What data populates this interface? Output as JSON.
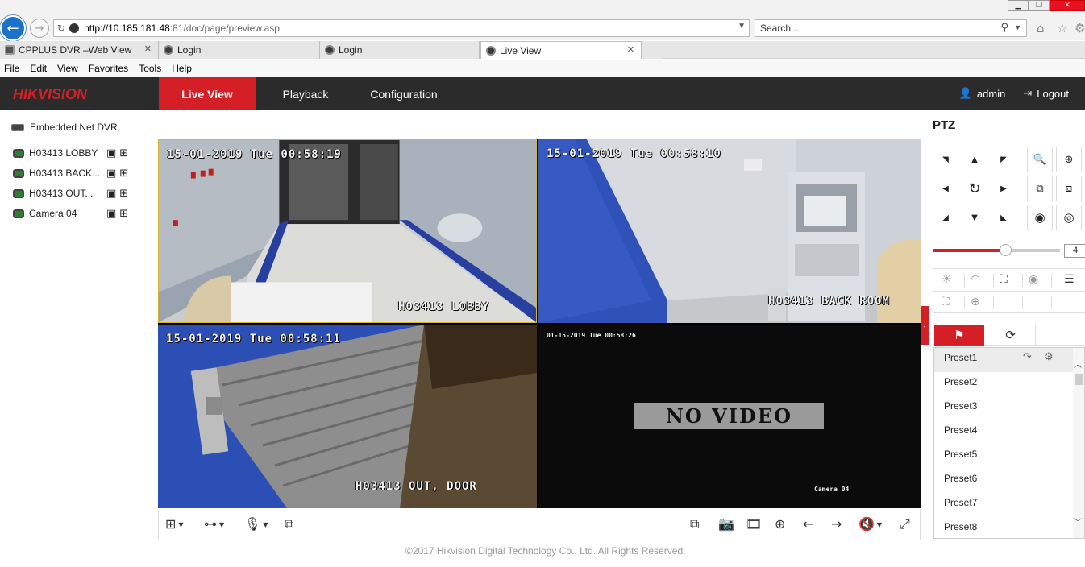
{
  "browser": {
    "address": {
      "host": "http://10.185.181.48",
      "rest": ":81/doc/page/preview.asp"
    },
    "search_placeholder": "Search...",
    "tabs": [
      {
        "label": "CPPLUS DVR –Web View"
      },
      {
        "label": "Login"
      },
      {
        "label": "Login"
      },
      {
        "label": "Live View"
      }
    ],
    "menu": [
      "File",
      "Edit",
      "View",
      "Favorites",
      "Tools",
      "Help"
    ]
  },
  "header": {
    "brand": "HIKVISION",
    "nav": [
      "Live View",
      "Playback",
      "Configuration"
    ],
    "active_nav": "Live View",
    "user": "admin",
    "logout": "Logout",
    "accent_color": "#d51f26"
  },
  "device_tree": {
    "root": "Embedded Net DVR",
    "cameras": [
      {
        "name": "H03413 LOBBY"
      },
      {
        "name": "H03413 BACK ROOM",
        "display": "H03413 BACK..."
      },
      {
        "name": "H03413 OUT, DOOR",
        "display": "H03413 OUT..."
      },
      {
        "name": "Camera 04"
      }
    ]
  },
  "video": {
    "cells": [
      {
        "timestamp": "15-01-2019 Tue 00:58:19",
        "label": "H03413 LOBBY"
      },
      {
        "timestamp": "15-01-2019 Tue 00:58:10",
        "label": "H03413 BACK ROOM"
      },
      {
        "timestamp": "15-01-2019 Tue 00:58:11",
        "label": "H03413 OUT, DOOR"
      },
      {
        "timestamp": "01-15-2019 Tue 00:58:26",
        "label": "Camera 04",
        "status": "NO VIDEO"
      }
    ]
  },
  "ptz": {
    "title": "PTZ",
    "speed": 4,
    "speed_max": 7,
    "presets": [
      "Preset1",
      "Preset2",
      "Preset3",
      "Preset4",
      "Preset5",
      "Preset6",
      "Preset7",
      "Preset8"
    ],
    "selected_preset": "Preset1"
  },
  "footer": {
    "copyright": "©2017 Hikvision Digital Technology Co., Ltd. All Rights Reserved."
  }
}
